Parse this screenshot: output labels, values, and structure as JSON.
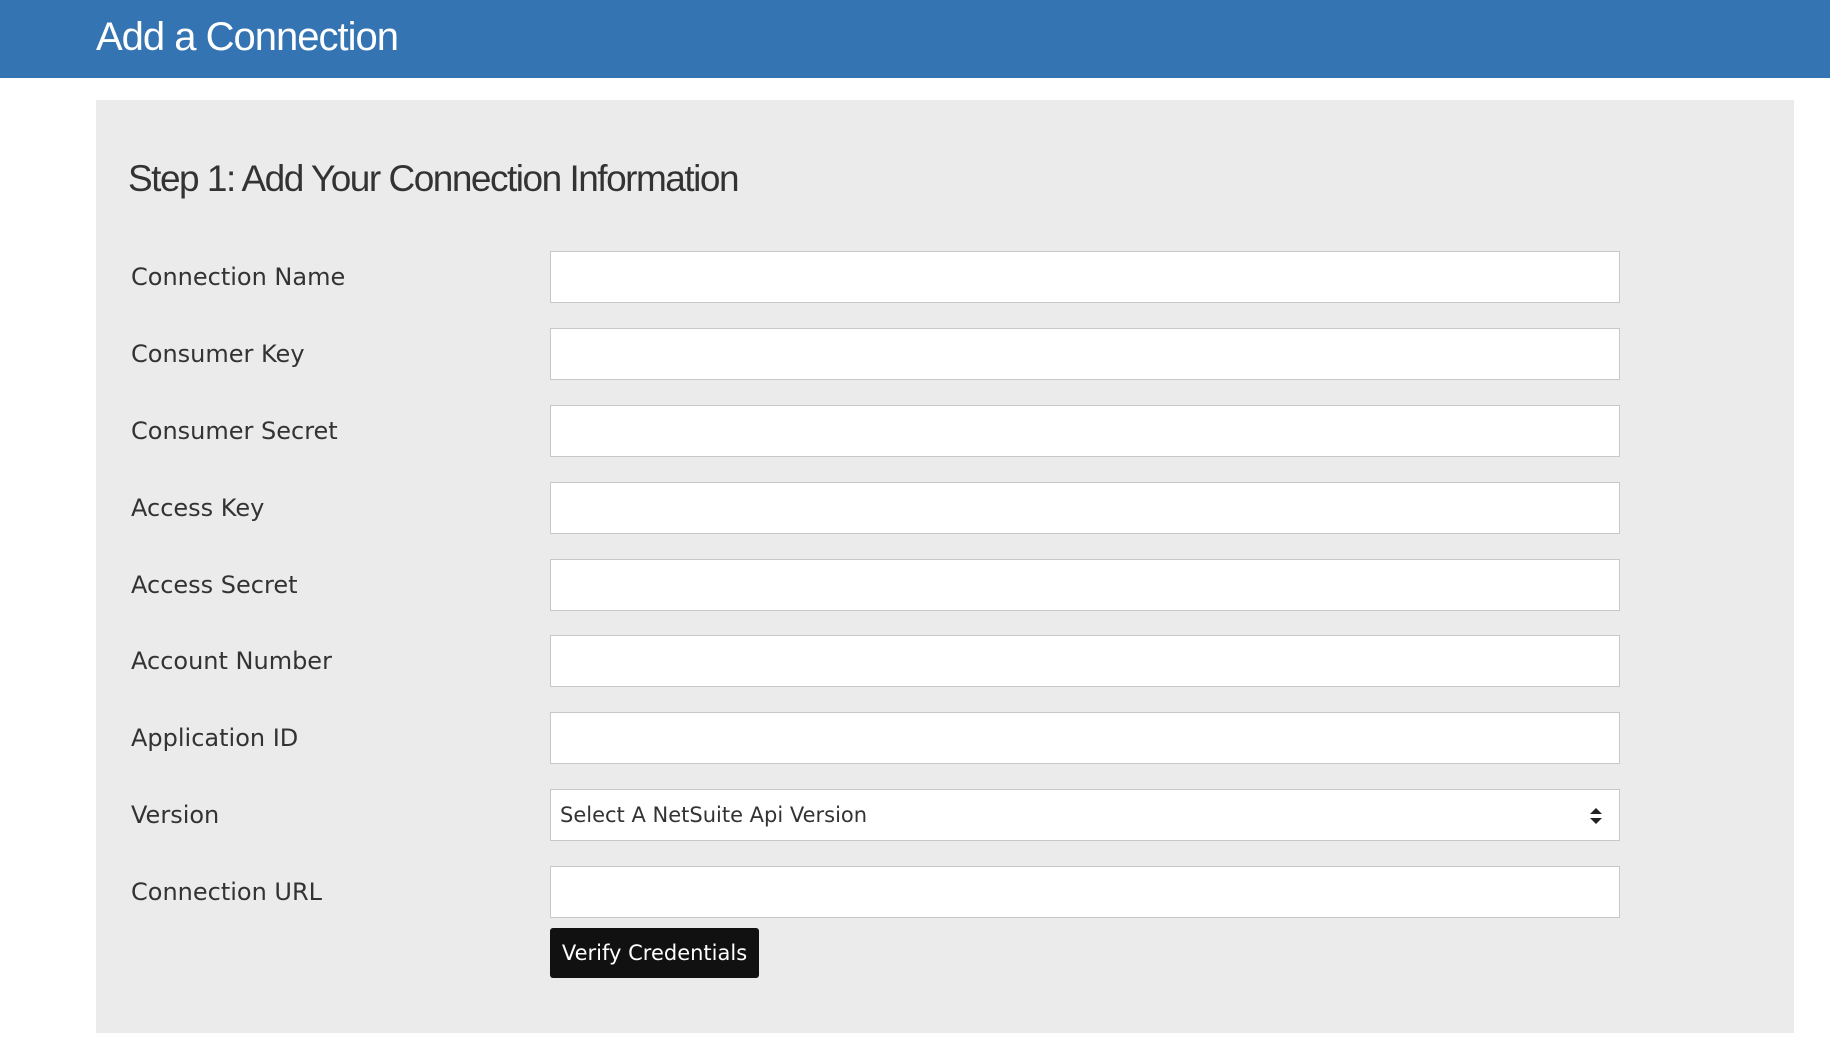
{
  "header": {
    "title": "Add a Connection"
  },
  "form": {
    "step_title": "Step 1: Add Your Connection Information",
    "fields": [
      {
        "label": "Connection Name",
        "value": ""
      },
      {
        "label": "Consumer Key",
        "value": ""
      },
      {
        "label": "Consumer Secret",
        "value": ""
      },
      {
        "label": "Access Key",
        "value": ""
      },
      {
        "label": "Access Secret",
        "value": ""
      },
      {
        "label": "Account Number",
        "value": ""
      },
      {
        "label": "Application ID",
        "value": ""
      },
      {
        "label": "Version",
        "selected": "Select A NetSuite Api Version"
      },
      {
        "label": "Connection URL",
        "value": ""
      }
    ],
    "verify_button": "Verify Credentials"
  },
  "colors": {
    "header_bg": "#3574b3",
    "panel_bg": "#ebebeb",
    "button_bg": "#111111"
  }
}
